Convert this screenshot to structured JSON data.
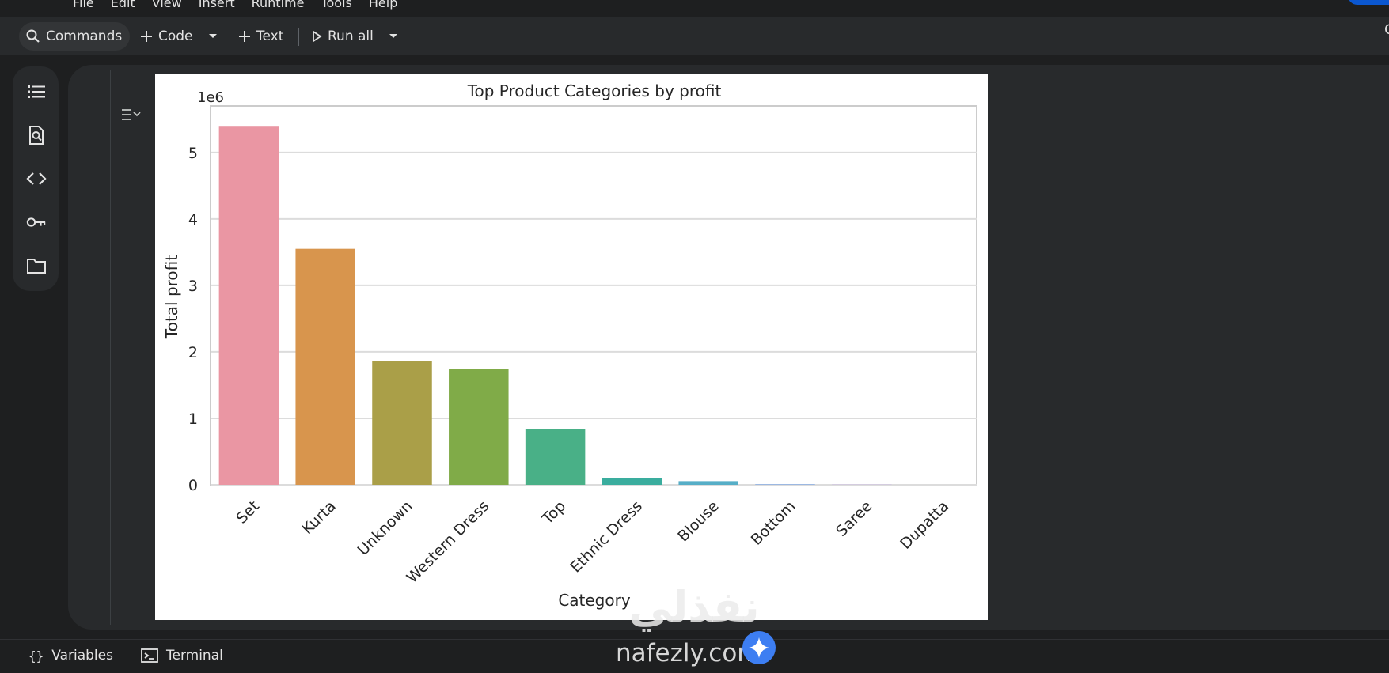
{
  "menu": {
    "items": [
      "File",
      "Edit",
      "View",
      "Insert",
      "Runtime",
      "Tools",
      "Help"
    ]
  },
  "toolbar": {
    "commands_label": "Commands",
    "code_label": "Code",
    "text_label": "Text",
    "run_all_label": "Run all",
    "right_glyph": "C"
  },
  "sidebar": {
    "icons": [
      "table-of-contents-icon",
      "find-in-page-icon",
      "code-snippets-icon",
      "secrets-key-icon",
      "files-folder-icon"
    ]
  },
  "statusbar": {
    "variables_glyph": "{}",
    "variables_label": "Variables",
    "terminal_label": "Terminal"
  },
  "watermark": {
    "arabic": "نفذلي",
    "latin": "nafezly.com"
  },
  "colors": {
    "background": "#1e1f20",
    "surface": "#282a2c",
    "accent": "#0b57d0"
  },
  "chart_data": {
    "type": "bar",
    "title": "Top Product Categories by profit",
    "xlabel": "Category",
    "ylabel": "Total profit",
    "y_offset_label": "1e6",
    "categories": [
      "Set",
      "Kurta",
      "Unknown",
      "Western Dress",
      "Top",
      "Ethnic Dress",
      "Blouse",
      "Bottom",
      "Saree",
      "Dupatta"
    ],
    "values": [
      5400000,
      3550000,
      1860000,
      1740000,
      840000,
      100000,
      55000,
      8000,
      3000,
      0
    ],
    "colors": [
      "#ea96a3",
      "#d8954d",
      "#aa9f48",
      "#80ab48",
      "#49b087",
      "#3aad9e",
      "#56aec7",
      "#7da6e5",
      "#b99be8",
      "#e890d6"
    ],
    "yticks": [
      "0",
      "1",
      "2",
      "3",
      "4",
      "5"
    ],
    "ylim": [
      0,
      5.7
    ],
    "grid": true,
    "legend": "none"
  }
}
